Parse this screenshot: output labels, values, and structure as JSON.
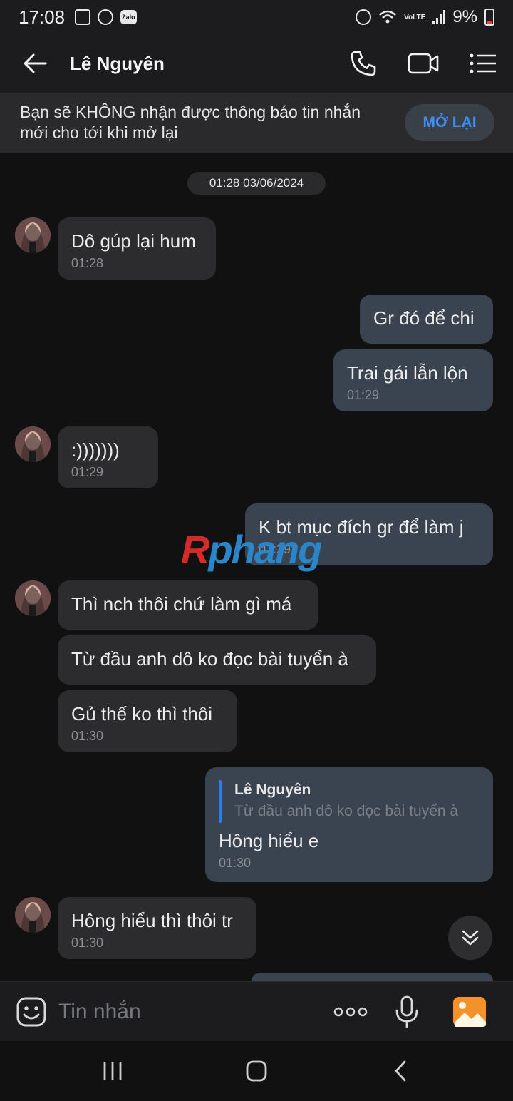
{
  "status_bar": {
    "time": "17:08",
    "battery": "9%",
    "left_icons": [
      "gallery-icon",
      "messenger-icon",
      "zalo-icon"
    ],
    "zalo_label": "Zalo",
    "lte_label": "VoLTE",
    "right_icons": [
      "alarm-icon",
      "wifi-icon",
      "volte-icon",
      "signal-icon",
      "battery-icon"
    ]
  },
  "header": {
    "contact_name": "Lê Nguyên",
    "icons": [
      "back-arrow-icon",
      "phone-icon",
      "video-call-icon",
      "menu-icon"
    ]
  },
  "notice": {
    "text": "Bạn sẽ KHÔNG nhận được thông báo tin nhắn mới cho tới khi mở lại",
    "button": "MỞ LẠI"
  },
  "date_separator": "01:28 03/06/2024",
  "messages": [
    {
      "side": "in",
      "text": "Dô gúp lại hum",
      "time": "01:28"
    },
    {
      "side": "out",
      "text": "Gr đó để chi",
      "time": ""
    },
    {
      "side": "out",
      "text": "Trai gái lẫn lộn",
      "time": "01:29"
    },
    {
      "side": "in",
      "text": ":)))))))",
      "time": "01:29"
    },
    {
      "side": "out",
      "text": "K bt mục đích gr để làm j",
      "time": "01:29"
    },
    {
      "side": "in",
      "text": "Thì nch thôi chứ làm gì má",
      "time": ""
    },
    {
      "side": "in",
      "text": "Từ đầu anh dô ko đọc bài tuyển à",
      "time": ""
    },
    {
      "side": "in",
      "text": "Gủ thế ko thì thôi",
      "time": "01:30"
    },
    {
      "side": "out",
      "quote_name": "Lê Nguyên",
      "quote_text": "Từ đầu anh dô ko đọc bài tuyển à",
      "text": "Hông hiểu e",
      "time": "01:30"
    },
    {
      "side": "in",
      "text": "Hông hiểu thì thôi tr",
      "time": "01:30"
    }
  ],
  "watermark": {
    "part1": "R",
    "part2": "phang"
  },
  "composer": {
    "placeholder": "Tin nhắn",
    "icons": [
      "sticker-icon",
      "more-icon",
      "microphone-icon",
      "image-icon"
    ]
  },
  "nav": {
    "icons": [
      "recent-apps-icon",
      "home-icon",
      "back-icon"
    ]
  },
  "colors": {
    "accent": "#3d8ef5",
    "outgoing_bubble": "#3a4350",
    "incoming_bubble": "#2c2c2e",
    "background": "#111112"
  }
}
